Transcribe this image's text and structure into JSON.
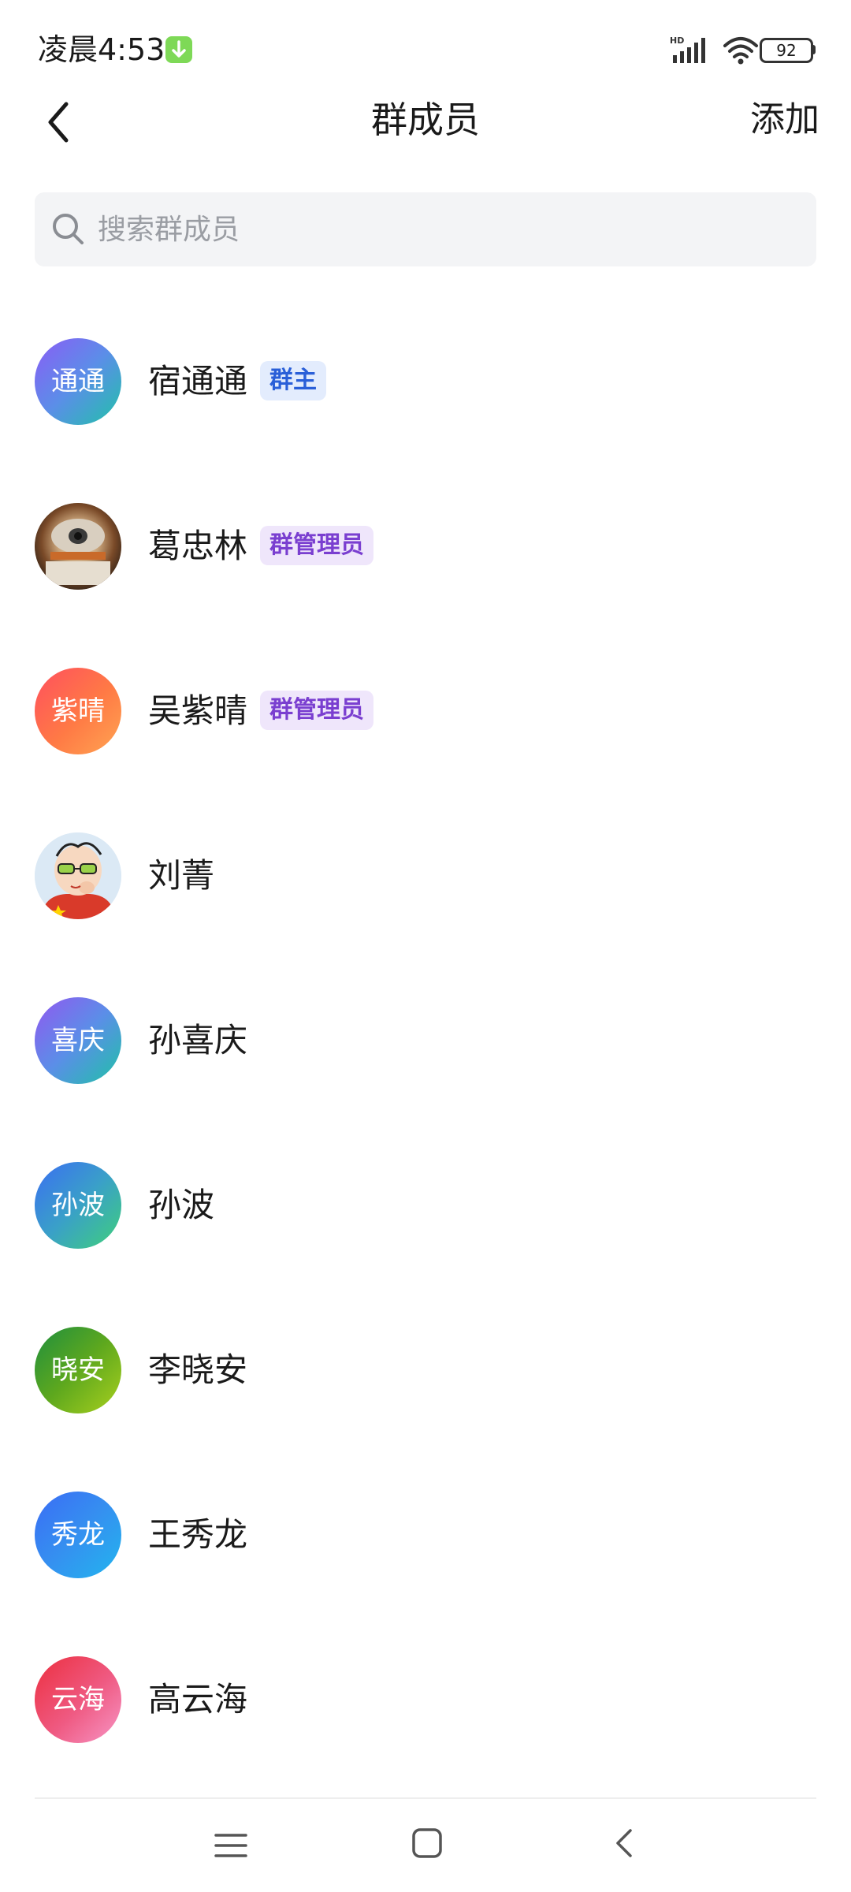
{
  "status_bar": {
    "time": "凌晨4:53",
    "battery": "92",
    "signal_label": "HD"
  },
  "header": {
    "title": "群成员",
    "add_label": "添加"
  },
  "search": {
    "placeholder": "搜索群成员"
  },
  "members": [
    {
      "avatar_text": "通通",
      "name": "宿通通",
      "role": "群主"
    },
    {
      "avatar_text": "",
      "name": "葛忠林",
      "role": "群管理员"
    },
    {
      "avatar_text": "紫晴",
      "name": "吴紫晴",
      "role": "群管理员"
    },
    {
      "avatar_text": "",
      "name": "刘菁",
      "role": ""
    },
    {
      "avatar_text": "喜庆",
      "name": "孙喜庆",
      "role": ""
    },
    {
      "avatar_text": "孙波",
      "name": "孙波",
      "role": ""
    },
    {
      "avatar_text": "晓安",
      "name": "李晓安",
      "role": ""
    },
    {
      "avatar_text": "秀龙",
      "name": "王秀龙",
      "role": ""
    },
    {
      "avatar_text": "云海",
      "name": "高云海",
      "role": ""
    }
  ],
  "colors": {
    "owner_badge_text": "#2a5fd8",
    "admin_badge_text": "#7a3fd0",
    "download_badge": "#7ed957"
  },
  "icons": {
    "back": "chevron-left-icon",
    "search": "magnifier-icon",
    "nav_menu": "menu-lines-icon",
    "nav_home": "square-icon",
    "nav_back": "chevron-left-icon"
  }
}
